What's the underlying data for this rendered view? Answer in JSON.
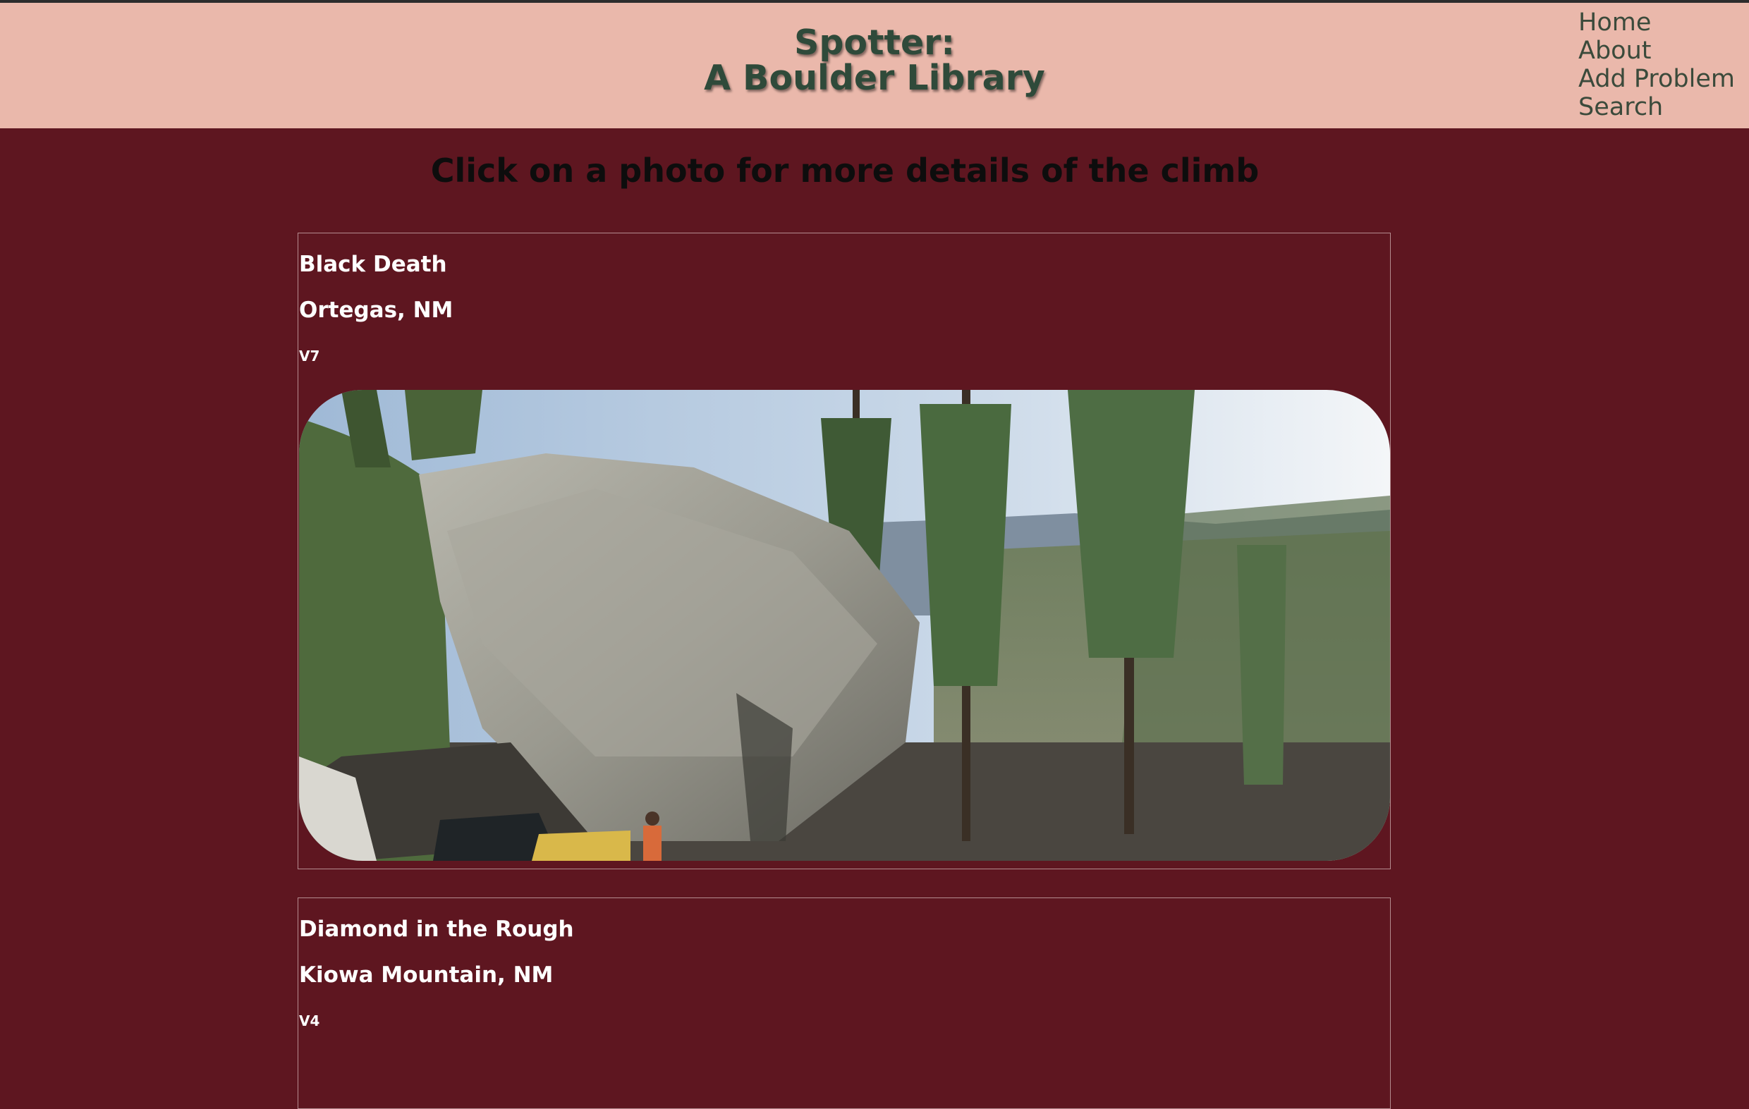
{
  "header": {
    "title_line1": "Spotter:",
    "title_line2": "A Boulder Library",
    "nav": [
      "Home",
      "About",
      "Add Problem",
      "Search"
    ]
  },
  "instruction": "Click on a photo for more details of the climb",
  "climbs": [
    {
      "name": "Black Death",
      "location": "Ortegas, NM",
      "grade": "V7"
    },
    {
      "name": "Diamond in the Rough",
      "location": "Kiowa Mountain, NM",
      "grade": "V4"
    }
  ],
  "colors": {
    "header_bg": "#eab8ab",
    "page_bg": "#5e1620",
    "title_text": "#2f4a3a"
  }
}
